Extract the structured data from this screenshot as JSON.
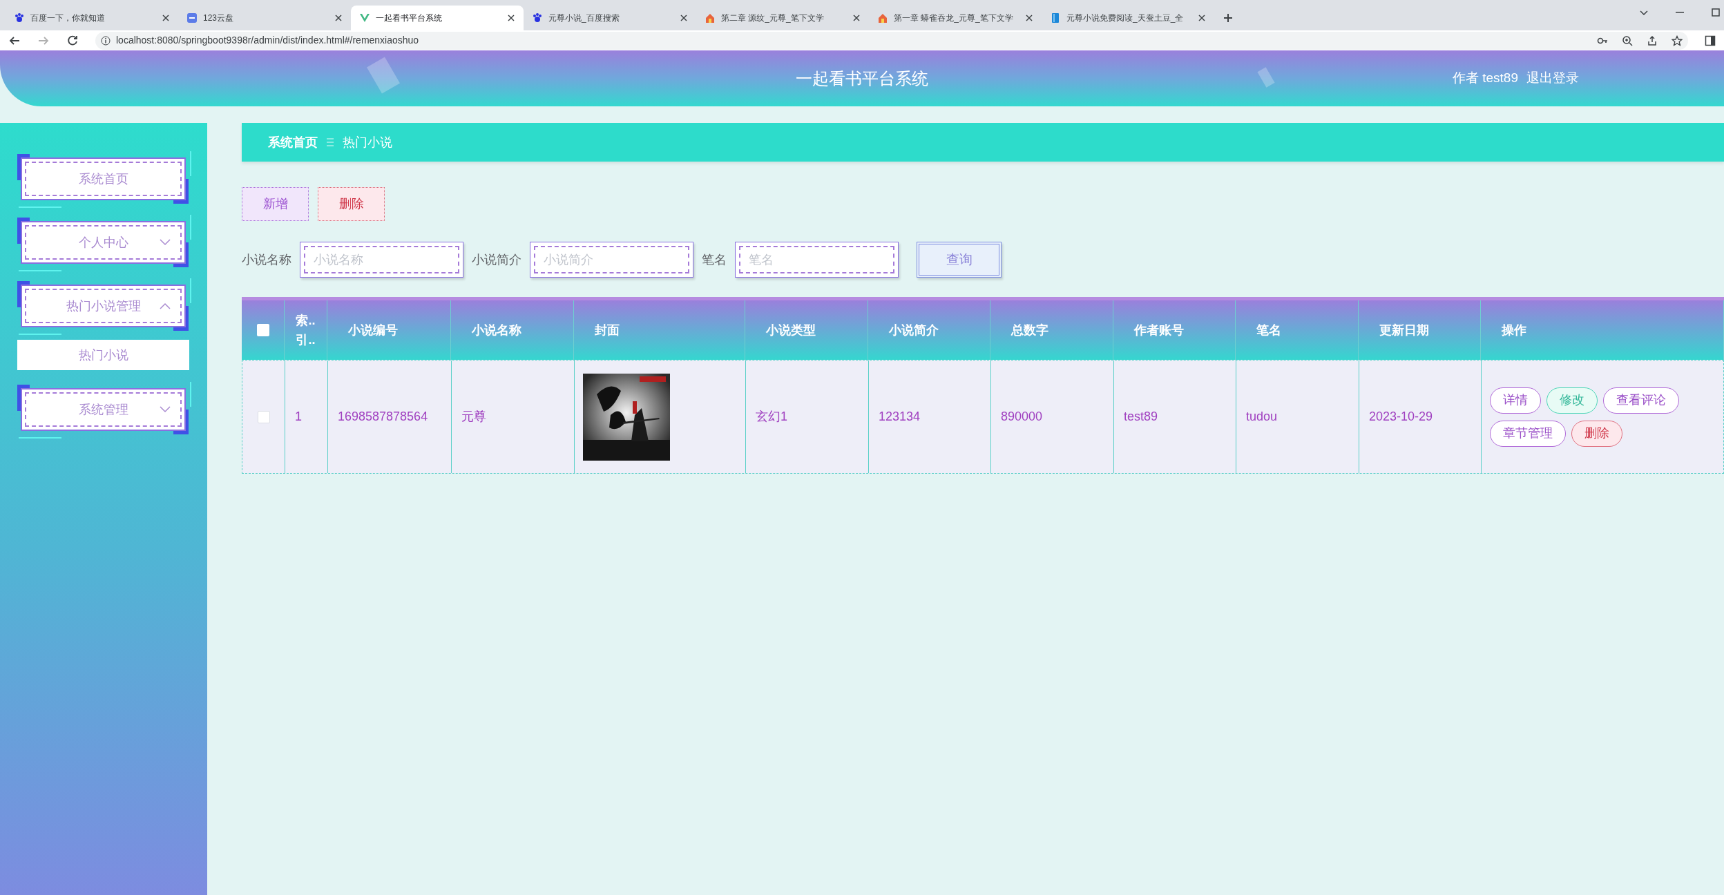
{
  "browser": {
    "tabs": [
      {
        "title": "百度一下，你就知道",
        "selected": false
      },
      {
        "title": "123云盘",
        "selected": false
      },
      {
        "title": "一起看书平台系统",
        "selected": true
      },
      {
        "title": "元尊小说_百度搜索",
        "selected": false
      },
      {
        "title": "第二章 源纹_元尊_笔下文学",
        "selected": false
      },
      {
        "title": "第一章 蟒雀吞龙_元尊_笔下文学",
        "selected": false
      },
      {
        "title": "元尊小说免费阅读_天蚕土豆_全",
        "selected": false
      }
    ],
    "url": "localhost:8080/springboot9398r/admin/dist/index.html#/remenxiaoshuo"
  },
  "header": {
    "title": "一起看书平台系统",
    "user": "作者 test89",
    "logout": "退出登录"
  },
  "sidebar": {
    "items": [
      {
        "label": "系统首页",
        "selected": false
      },
      {
        "label": "个人中心",
        "selected": false,
        "expanded": false
      },
      {
        "label": "热门小说管理",
        "selected": false,
        "expanded": true,
        "children": [
          {
            "label": "热门小说",
            "selected": true
          }
        ]
      },
      {
        "label": "系统管理",
        "selected": false,
        "expanded": false
      }
    ]
  },
  "breadcrumb": [
    "系统首页",
    "热门小说"
  ],
  "actions": [
    {
      "label": "新增",
      "kind": "add"
    },
    {
      "label": "删除",
      "kind": "delete"
    }
  ],
  "search": {
    "fields": [
      {
        "label": "小说名称",
        "placeholder": "小说名称"
      },
      {
        "label": "小说简介",
        "placeholder": "小说简介"
      },
      {
        "label": "笔名",
        "placeholder": "笔名"
      }
    ],
    "button": "查询"
  },
  "table": {
    "all_selected": false,
    "columns": [
      "索..\n引..",
      "小说编号",
      "小说名称",
      "封面",
      "小说类型",
      "小说简介",
      "总数字",
      "作者账号",
      "笔名",
      "更新日期",
      "操作"
    ],
    "rows": [
      {
        "selected": false,
        "index": "1",
        "number": "1698587878564",
        "name": "元尊",
        "type": "玄幻1",
        "intro": "123134",
        "words": "890000",
        "account": "test89",
        "pen_name": "tudou",
        "date": "2023-10-29",
        "actions": [
          {
            "label": "详情",
            "kind": "detail"
          },
          {
            "label": "修改",
            "kind": "edit"
          },
          {
            "label": "查看评论",
            "kind": "detail"
          },
          {
            "label": "章节管理",
            "kind": "detail"
          },
          {
            "label": "删除",
            "kind": "delete"
          }
        ]
      }
    ]
  }
}
